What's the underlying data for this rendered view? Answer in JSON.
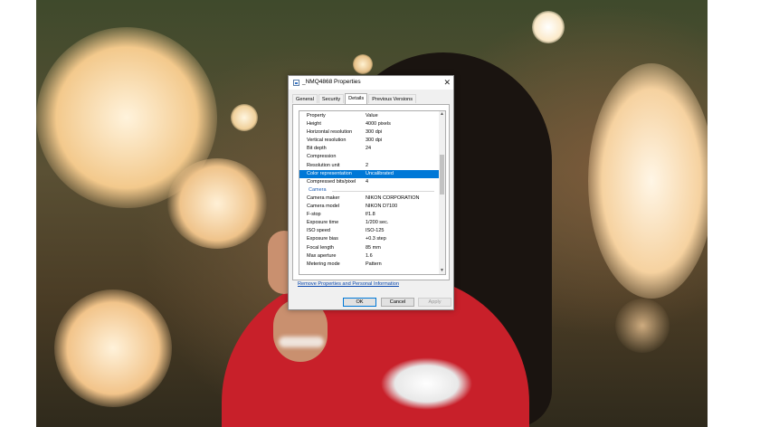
{
  "dialog": {
    "title": "_NMQ4868 Properties",
    "tabs": [
      {
        "label": "General"
      },
      {
        "label": "Security"
      },
      {
        "label": "Details"
      },
      {
        "label": "Previous Versions"
      }
    ],
    "columns": {
      "property": "Property",
      "value": "Value"
    },
    "rows": [
      {
        "property": "Height",
        "value": "4000 pixels"
      },
      {
        "property": "Horizontal resolution",
        "value": "300 dpi"
      },
      {
        "property": "Vertical resolution",
        "value": "300 dpi"
      },
      {
        "property": "Bit depth",
        "value": "24"
      },
      {
        "property": "Compression",
        "value": ""
      },
      {
        "property": "Resolution unit",
        "value": "2"
      },
      {
        "property": "Color representation",
        "value": "Uncalibrated"
      },
      {
        "property": "Compressed bits/pixel",
        "value": "4"
      }
    ],
    "section_camera": "Camera",
    "camera_rows": [
      {
        "property": "Camera maker",
        "value": "NIKON CORPORATION"
      },
      {
        "property": "Camera model",
        "value": "NIKON D7100"
      },
      {
        "property": "F-stop",
        "value": "f/1.8"
      },
      {
        "property": "Exposure time",
        "value": "1/200 sec."
      },
      {
        "property": "ISO speed",
        "value": "ISO-125"
      },
      {
        "property": "Exposure bias",
        "value": "+0.3 step"
      },
      {
        "property": "Focal length",
        "value": "85 mm"
      },
      {
        "property": "Max aperture",
        "value": "1.6"
      },
      {
        "property": "Metering mode",
        "value": "Pattern"
      }
    ],
    "remove_link": "Remove Properties and Personal Information",
    "buttons": {
      "ok": "OK",
      "cancel": "Cancel",
      "apply": "Apply"
    },
    "close_glyph": "✕",
    "selection_color": "#0078d7"
  }
}
